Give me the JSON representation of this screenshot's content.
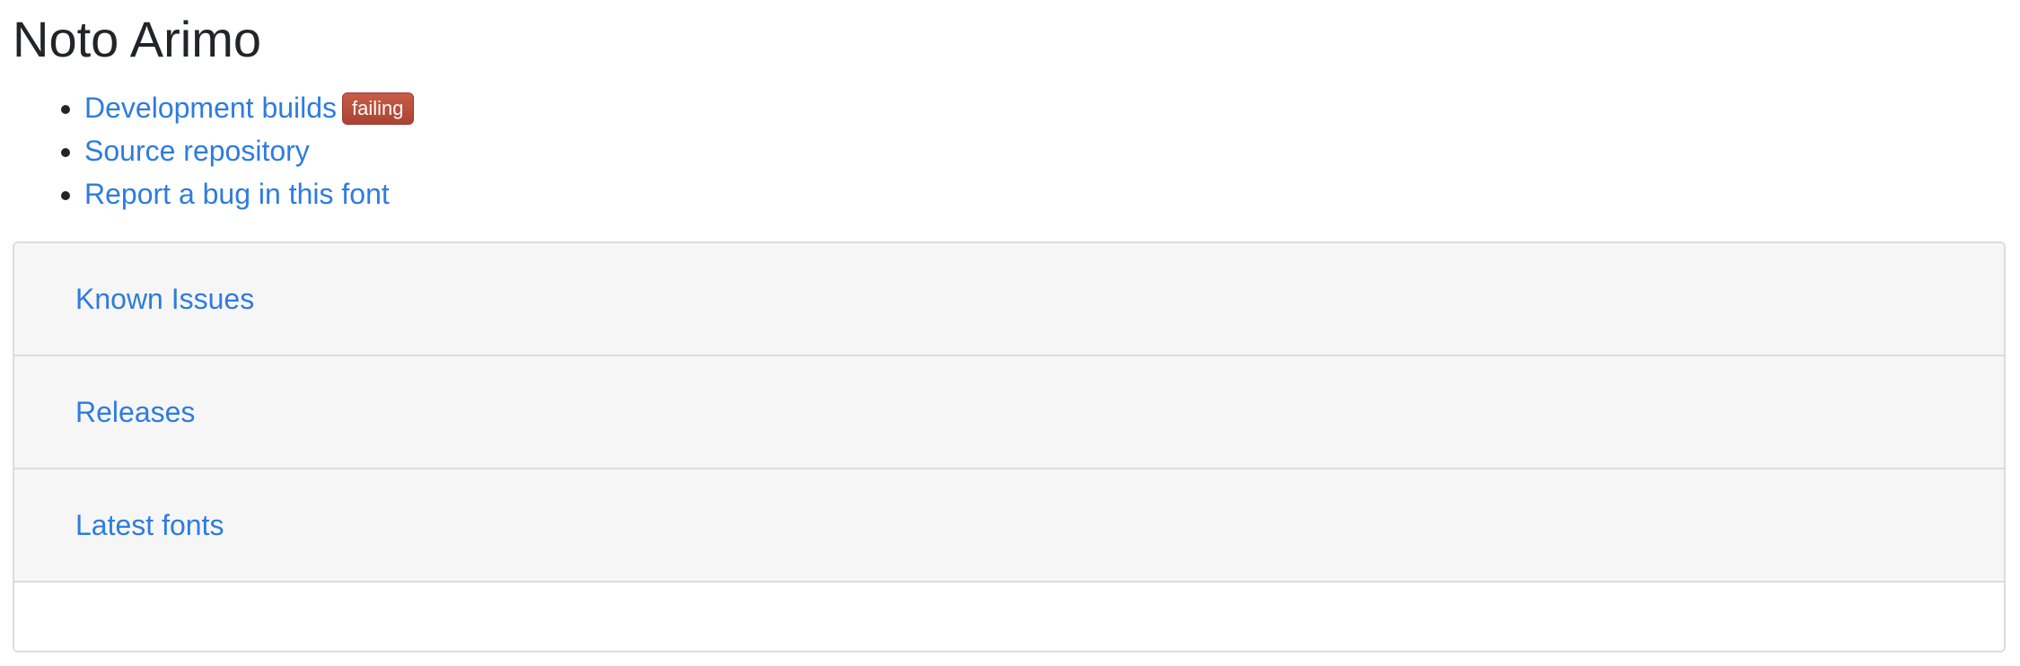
{
  "page": {
    "title": "Noto Arimo"
  },
  "links": [
    {
      "label": "Development builds",
      "badge": "failing"
    },
    {
      "label": "Source repository"
    },
    {
      "label": "Report a bug in this font"
    }
  ],
  "accordion": {
    "items": [
      {
        "label": "Known Issues"
      },
      {
        "label": "Releases"
      },
      {
        "label": "Latest fonts"
      }
    ]
  },
  "colors": {
    "link": "#2e7cdf",
    "badge_failing": "#b54b38",
    "panel_background": "#f6f6f6",
    "border": "#dcdcdc"
  }
}
